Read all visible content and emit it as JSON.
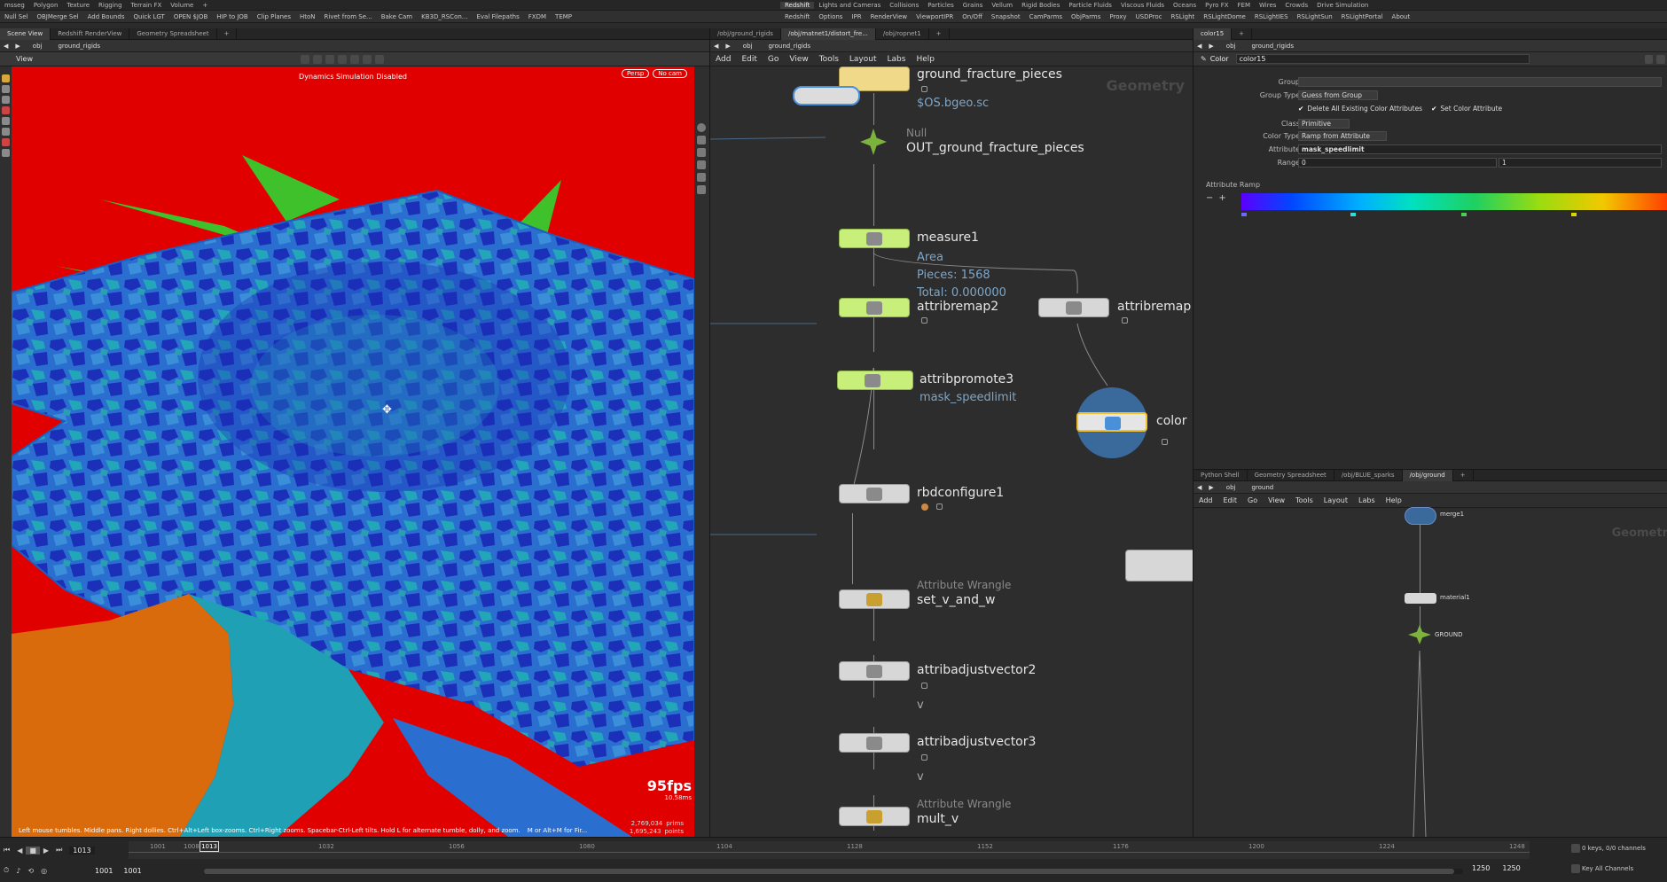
{
  "shelves": {
    "left": [
      "msseg",
      "Polygon",
      "Texture",
      "Rigging",
      "Terrain FX",
      "Volume"
    ],
    "right": [
      "Redshift",
      "Lights and Cameras",
      "Collisions",
      "Particles",
      "Grains",
      "Vellum",
      "Rigid Bodies",
      "Particle Fluids",
      "Viscous Fluids",
      "Oceans",
      "Pyro FX",
      "FEM",
      "Wires",
      "Crowds",
      "Drive Simulation"
    ]
  },
  "tools": {
    "left": [
      "Null Sel",
      "OBJMerge Sel",
      "Add Bounds",
      "Quick LGT",
      "OPEN $JOB",
      "HIP to JOB",
      "Clip Planes",
      "HtoN",
      "Rivet from Se...",
      "Bake Cam",
      "KB3D_RSCon...",
      "Eval Filepaths",
      "FXDM",
      "TEMP"
    ],
    "right": [
      "Redshift",
      "Options",
      "IPR",
      "RenderView",
      "ViewportIPR",
      "On/Off",
      "Snapshot",
      "CamParms",
      "ObjParms",
      "Proxy",
      "USDProc",
      "RSLight",
      "RSLightDome",
      "RSLightIES",
      "RSLightSun",
      "RSLightPortal",
      "About"
    ]
  },
  "viewer": {
    "tabs": [
      "Scene View",
      "Redshift RenderView",
      "Geometry Spreadsheet"
    ],
    "path": [
      "obj",
      "ground_rigids"
    ],
    "label": "View",
    "status": "Dynamics Simulation Disabled",
    "persp": "Persp",
    "cam": "No cam",
    "fps": "95fps",
    "ms": "10.58ms",
    "stat1": "2,769,034",
    "stat1_unit": "prims",
    "stat2": "1,695,243",
    "stat2_unit": "points",
    "hint": "Left mouse tumbles. Middle pans. Right dollies. Ctrl+Alt+Left box-zooms. Ctrl+Right zooms. Spacebar-Ctrl-Left tilts. Hold L for alternate tumble, dolly, and zoom.",
    "hint2": "M or Alt+M for Fir..."
  },
  "network": {
    "tabs": [
      "/obj/ground_rigids",
      "/obj/matnet1/distort_fre...",
      "/obj/ropnet1"
    ],
    "path": [
      "obj",
      "ground_rigids"
    ],
    "menu": [
      "Add",
      "Edit",
      "Go",
      "View",
      "Tools",
      "Layout",
      "Labs",
      "Help"
    ],
    "context_label": "Geometry",
    "nodes": {
      "n1": {
        "name": "ground_fracture_pieces",
        "sub": "$OS.bgeo.sc"
      },
      "n2": {
        "type": "Null",
        "name": "OUT_ground_fracture_pieces"
      },
      "n3": {
        "name": "measure1",
        "sub1": "Area",
        "sub2": "Pieces: 1568",
        "sub3": "Total: 0.000000"
      },
      "n4": {
        "name": "attribremap2"
      },
      "n5": {
        "name": "attribremap"
      },
      "n6": {
        "name": "attribpromote3",
        "sub": "mask_speedlimit"
      },
      "n7": {
        "name": "color"
      },
      "n8": {
        "name": "rbdconfigure1"
      },
      "n9": {
        "type": "Attribute Wrangle",
        "name": "set_v_and_w"
      },
      "n10": {
        "name": "attribadjustvector2",
        "sub": "v"
      },
      "n11": {
        "name": "attribadjustvector3",
        "sub": "v"
      },
      "n12": {
        "type": "Attribute Wrangle",
        "name": "mult_v"
      }
    }
  },
  "params": {
    "tabs": [
      "color15"
    ],
    "path": [
      "obj",
      "ground_rigids"
    ],
    "node_type": "Color",
    "node_name": "color15",
    "rows": [
      {
        "label": "Group",
        "value": ""
      },
      {
        "label": "Group Type",
        "value": "Guess from Group"
      },
      {
        "label": "Class",
        "value": "Primitive"
      },
      {
        "label": "Color Type",
        "value": "Ramp from Attribute"
      },
      {
        "label": "Attribute",
        "value": "mask_speedlimit"
      },
      {
        "label": "Range",
        "value": "0",
        "value2": "1"
      }
    ],
    "check1": "Delete All Existing Color Attributes",
    "check2": "Set Color Attribute",
    "ramp_label": "Attribute Ramp"
  },
  "network2": {
    "tabs": [
      "Python Shell",
      "Geometry Spreadsheet",
      "/obj/BLUE_sparks",
      "/obj/ground"
    ],
    "path": [
      "obj",
      "ground"
    ],
    "menu": [
      "Add",
      "Edit",
      "Go",
      "View",
      "Tools",
      "Layout",
      "Labs",
      "Help"
    ],
    "context_label": "Geometr",
    "nodes": [
      "merge1",
      "material1",
      "GROUND"
    ]
  },
  "timeline": {
    "ticks": [
      "1001",
      "1008",
      "1032",
      "1056",
      "1080",
      "1104",
      "1128",
      "1152",
      "1176",
      "1200",
      "1224",
      "1248"
    ],
    "current": "1013",
    "start": "1001",
    "start2": "1001",
    "end": "1250",
    "end2": "1250",
    "keys": "0 keys, 0/0 channels",
    "key_all": "Key All Channels"
  },
  "colors": {
    "accent": "#4a90d9",
    "viewport_red": "#e00000",
    "mesh_blue": "#2a6fd0",
    "mesh_dark": "#1b2fb8",
    "mesh_cyan": "#22a7b8",
    "spike_green": "#3ec12b",
    "node_green": "#c8ef7a"
  }
}
